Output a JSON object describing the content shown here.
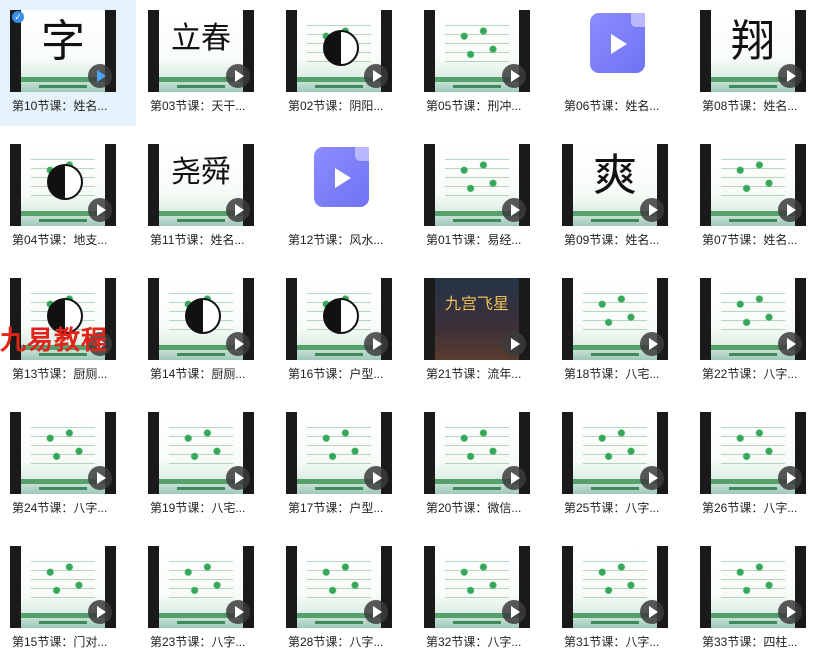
{
  "grid": {
    "items": [
      {
        "label": "第10节课：姓名...",
        "thumb": "字",
        "thumb_kind": "char"
      },
      {
        "label": "第03节课：天干...",
        "thumb": "立春",
        "thumb_kind": "char-small"
      },
      {
        "label": "第02节课：阴阳...",
        "thumb": "",
        "thumb_kind": "bagua"
      },
      {
        "label": "第05节课：刑冲...",
        "thumb": "",
        "thumb_kind": "deco"
      },
      {
        "label": "第06节课：姓名...",
        "thumb": "",
        "thumb_kind": "file"
      },
      {
        "label": "第08节课：姓名...",
        "thumb": "翔",
        "thumb_kind": "char"
      },
      {
        "label": "第04节课：地支...",
        "thumb": "",
        "thumb_kind": "bagua"
      },
      {
        "label": "第11节课：姓名...",
        "thumb": "尧舜",
        "thumb_kind": "char-small"
      },
      {
        "label": "第12节课：风水...",
        "thumb": "",
        "thumb_kind": "file"
      },
      {
        "label": "第01节课：易经...",
        "thumb": "",
        "thumb_kind": "deco"
      },
      {
        "label": "第09节课：姓名...",
        "thumb": "爽",
        "thumb_kind": "char"
      },
      {
        "label": "第07节课：姓名...",
        "thumb": "",
        "thumb_kind": "deco"
      },
      {
        "label": "第13节课：厨厕...",
        "thumb": "",
        "thumb_kind": "bagua"
      },
      {
        "label": "第14节课：厨厕...",
        "thumb": "",
        "thumb_kind": "bagua"
      },
      {
        "label": "第16节课：户型...",
        "thumb": "",
        "thumb_kind": "bagua"
      },
      {
        "label": "第21节课：流年...",
        "thumb": "九宫飞星",
        "thumb_kind": "dark"
      },
      {
        "label": "第18节课：八宅...",
        "thumb": "",
        "thumb_kind": "deco"
      },
      {
        "label": "第22节课：八字...",
        "thumb": "",
        "thumb_kind": "deco"
      },
      {
        "label": "第24节课：八字...",
        "thumb": "",
        "thumb_kind": "deco"
      },
      {
        "label": "第19节课：八宅...",
        "thumb": "",
        "thumb_kind": "deco"
      },
      {
        "label": "第17节课：户型...",
        "thumb": "",
        "thumb_kind": "deco"
      },
      {
        "label": "第20节课：微信...",
        "thumb": "",
        "thumb_kind": "deco"
      },
      {
        "label": "第25节课：八字...",
        "thumb": "",
        "thumb_kind": "deco"
      },
      {
        "label": "第26节课：八字...",
        "thumb": "",
        "thumb_kind": "deco"
      },
      {
        "label": "第15节课：门对...",
        "thumb": "",
        "thumb_kind": "deco"
      },
      {
        "label": "第23节课：八字...",
        "thumb": "",
        "thumb_kind": "deco"
      },
      {
        "label": "第28节课：八字...",
        "thumb": "",
        "thumb_kind": "deco"
      },
      {
        "label": "第32节课：八字...",
        "thumb": "",
        "thumb_kind": "deco"
      },
      {
        "label": "第31节课：八字...",
        "thumb": "",
        "thumb_kind": "deco"
      },
      {
        "label": "第33节课：四柱...",
        "thumb": "",
        "thumb_kind": "deco"
      }
    ]
  },
  "watermark": {
    "text": "九易教程"
  },
  "colors": {
    "selection": "#e5f1fb",
    "accent": "#3b8ee8",
    "play_bg": "#3c3c3c",
    "file_icon": "#7b7ef6",
    "watermark": "#e2231a"
  }
}
